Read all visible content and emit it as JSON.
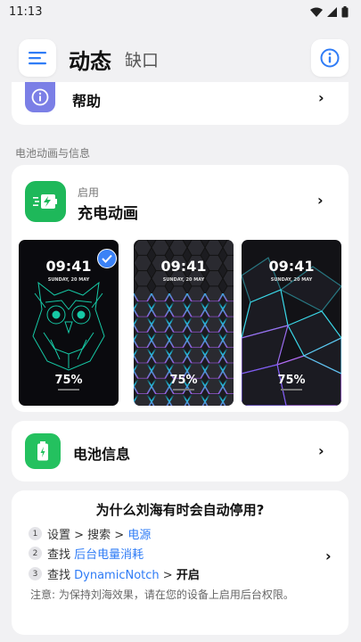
{
  "status_bar": {
    "time": "11:13"
  },
  "header": {
    "title": "动态",
    "subtitle": "缺口"
  },
  "help": {
    "label": "帮助"
  },
  "section": {
    "label": "电池动画与信息"
  },
  "charge": {
    "small": "启用",
    "title": "充电动画",
    "thumbs": [
      {
        "time": "09:41",
        "date": "SUNDAY, 20 MAY",
        "percent": "75%",
        "selected": true
      },
      {
        "time": "09:41",
        "date": "SUNDAY, 20 MAY",
        "percent": "75%"
      },
      {
        "time": "09:41",
        "date": "SUNDAY, 20 MAY",
        "percent": "75%"
      }
    ]
  },
  "battery": {
    "label": "电池信息"
  },
  "why": {
    "title": "为什么刘海有时会自动停用?",
    "steps": [
      {
        "num": "1",
        "prefix": "设置 > 搜索 > ",
        "highlight": "电源"
      },
      {
        "num": "2",
        "prefix": "查找 ",
        "highlight": "后台电量消耗"
      },
      {
        "num": "3",
        "prefix": "查找 ",
        "highlight": "DynamicNotch",
        "suffix_op": " > ",
        "suffix": "开启"
      }
    ],
    "note": "注意: 为保持刘海效果，请在您的设备上启用后台权限。"
  },
  "colors": {
    "accent": "#2f7cf6",
    "green": "#1eb85a",
    "help_icon": "#7b7fe6"
  }
}
